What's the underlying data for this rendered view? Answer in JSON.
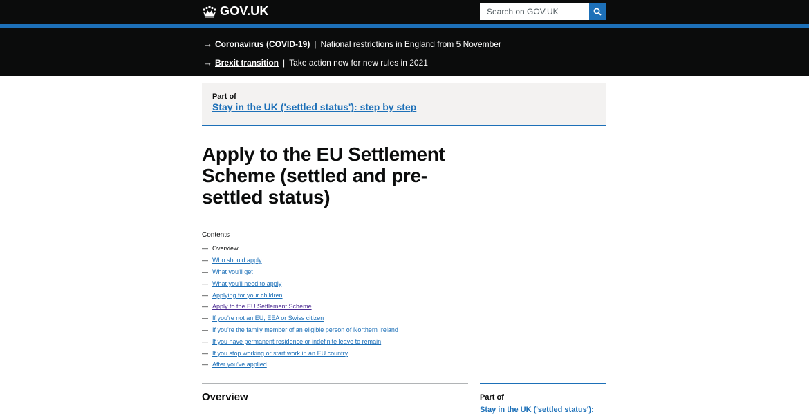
{
  "header": {
    "logo_text": "GOV.UK",
    "search_placeholder": "Search on GOV.UK"
  },
  "notices": [
    {
      "link": "Coronavirus (COVID-19)",
      "description": "National restrictions in England from 5 November"
    },
    {
      "link": "Brexit transition",
      "description": "Take action now for new rules in 2021"
    }
  ],
  "step_nav": {
    "part_of_label": "Part of",
    "link": "Stay in the UK ('settled status'): step by step"
  },
  "page_title": "Apply to the EU Settlement Scheme (settled and pre-settled status)",
  "contents": {
    "heading": "Contents",
    "items": [
      {
        "label": "Overview",
        "current": true
      },
      {
        "label": "Who should apply"
      },
      {
        "label": "What you'll get"
      },
      {
        "label": "What you'll need to apply"
      },
      {
        "label": "Applying for your children"
      },
      {
        "label": "Apply to the EU Settlement Scheme",
        "visited": true
      },
      {
        "label": "If you're not an EU, EEA or Swiss citizen"
      },
      {
        "label": "If you're the family member of an eligible person of Northern Ireland"
      },
      {
        "label": "If you have permanent residence or indefinite leave to remain"
      },
      {
        "label": "If you stop working or start work in an EU country"
      },
      {
        "label": "After you've applied"
      }
    ]
  },
  "overview_heading": "Overview",
  "sidebar": {
    "part_of_label": "Part of",
    "link": "Stay in the UK ('settled status'):"
  },
  "colors": {
    "brand_blue": "#1d70b8",
    "header_black": "#0b0c0c",
    "link_visited": "#4c2c92",
    "panel_grey": "#f3f2f1"
  }
}
